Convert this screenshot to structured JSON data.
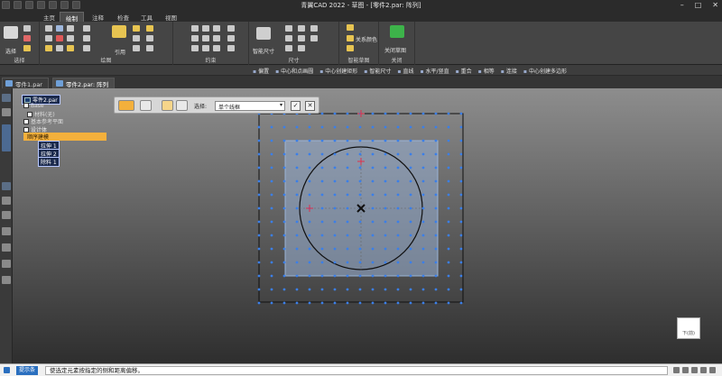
{
  "window": {
    "title": "青翼CAD 2022 - 草图 - [零件2.par: 阵列]",
    "minimize": "–",
    "maximize": "□",
    "close": "✕"
  },
  "ribbon_tabs": [
    {
      "label": "主页",
      "active": false
    },
    {
      "label": "绘制",
      "active": true
    },
    {
      "label": "注释",
      "active": false
    },
    {
      "label": "检查",
      "active": false
    },
    {
      "label": "工具",
      "active": false
    },
    {
      "label": "视图",
      "active": false
    }
  ],
  "ribbon": {
    "select_label": "选择",
    "select_group": "选择",
    "draw_group": "绘图",
    "reuse_label": "引用",
    "constraint_group": "约束",
    "smart_dimension_label": "智能尺寸",
    "dimension_group": "尺寸",
    "relation_color_label": "关系颜色",
    "intelligent_sketch_group": "智能草图",
    "close_sketch_label": "关闭草图",
    "close_group": "关闭"
  },
  "command_bar": [
    "偏置",
    "中心和点画圆",
    "中心创建矩形",
    "智能尺寸",
    "直线",
    "水平/竖直",
    "重合",
    "相等",
    "连接",
    "中心创建多边形"
  ],
  "doc_tabs": [
    {
      "label": "零件1.par",
      "active": false
    },
    {
      "label": "零件2.par: 阵列",
      "active": true
    }
  ],
  "feature_tree": {
    "root": "零件2.par",
    "items": [
      "Base",
      "材料(无)",
      "基本参考平面",
      "设计体",
      "顺序建模",
      "拉伸 1",
      "拉伸 2",
      "除料 1"
    ]
  },
  "mini_toolbar": {
    "select_label": "选择:",
    "select_value": "单个线框"
  },
  "view_cube_label": "下(前)",
  "status": {
    "label": "提示条",
    "message": "使选定元素按指定的侧和距离偏移。"
  },
  "colors": {
    "ribbon_bg": "#454545",
    "accent_active": "#f3b03c",
    "grid_dot": "#3b7fe8",
    "sketch_fill": "#9ab3d6",
    "constraint_red": "#e0304a"
  }
}
